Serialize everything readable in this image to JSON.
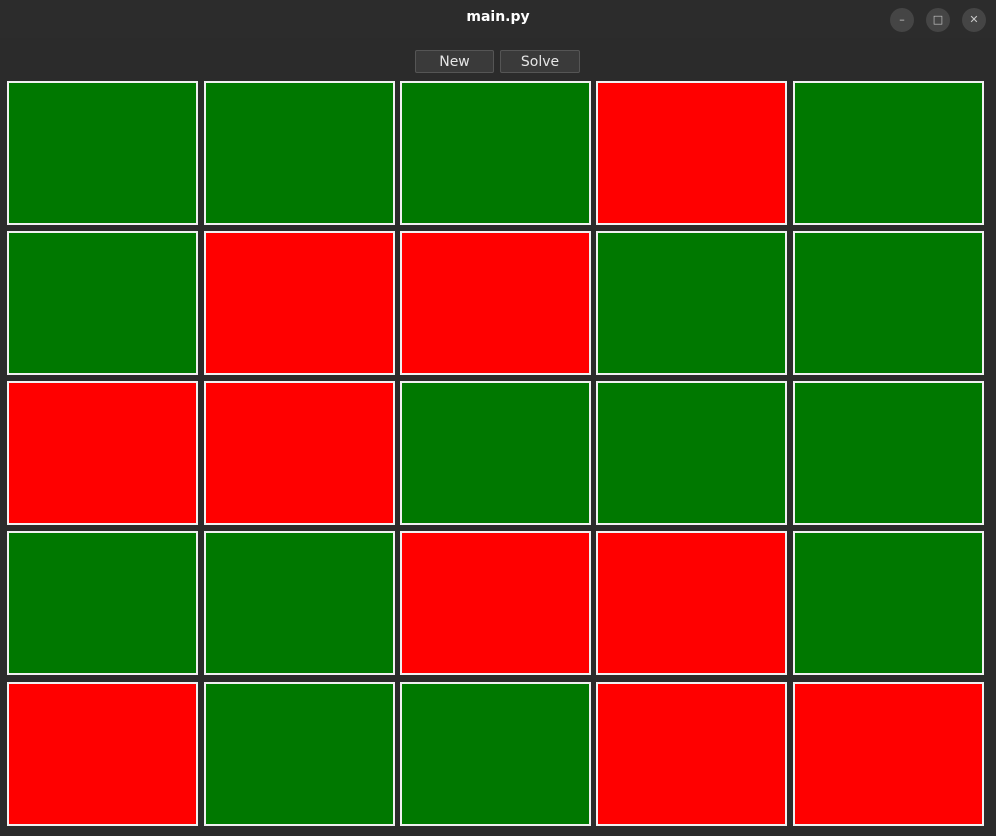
{
  "window": {
    "title": "main.py",
    "controls": {
      "minimize_glyph": "–",
      "maximize_glyph": "□",
      "close_glyph": "✕"
    }
  },
  "toolbar": {
    "new_label": "New",
    "solve_label": "Solve"
  },
  "colors": {
    "on": "#ff0000",
    "off": "#007800",
    "cell_border": "#f0f0f0",
    "background": "#2b2b2b"
  },
  "board": {
    "rows": 5,
    "cols": 5,
    "cells": [
      [
        "green",
        "green",
        "green",
        "red",
        "green"
      ],
      [
        "green",
        "red",
        "red",
        "green",
        "green"
      ],
      [
        "red",
        "red",
        "green",
        "green",
        "green"
      ],
      [
        "green",
        "green",
        "red",
        "red",
        "green"
      ],
      [
        "red",
        "green",
        "green",
        "red",
        "red"
      ]
    ]
  }
}
